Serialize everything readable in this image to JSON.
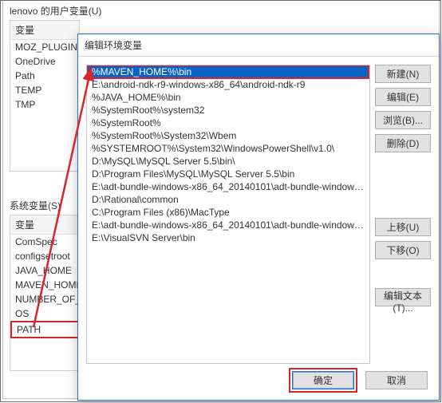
{
  "bg": {
    "user_vars_label": "lenovo 的用户变量(U)",
    "user_vars_header": "变量",
    "user_vars": [
      "MOZ_PLUGIN_P",
      "OneDrive",
      "Path",
      "TEMP",
      "TMP"
    ],
    "sys_vars_label": "系统变量(S)",
    "sys_vars_header": "变量",
    "sys_vars": [
      "ComSpec",
      "configsetroot",
      "JAVA_HOME",
      "MAVEN_HOME",
      "NUMBER_OF_PR",
      "OS",
      "PATH"
    ]
  },
  "dialog": {
    "title": "编辑环境变量",
    "entries": [
      "%MAVEN_HOME%\\bin",
      "E:\\android-ndk-r9-windows-x86_64\\android-ndk-r9",
      "%JAVA_HOME%\\bin",
      "%SystemRoot%\\system32",
      "%SystemRoot%",
      "%SystemRoot%\\System32\\Wbem",
      "%SYSTEMROOT%\\System32\\WindowsPowerShell\\v1.0\\",
      "D:\\MySQL\\MySQL Server 5.5\\bin\\",
      "D:\\Program Files\\MySQL\\MySQL Server 5.5\\bin",
      "E:\\adt-bundle-windows-x86_64_20140101\\adt-bundle-windows-x...",
      "D:\\Rational\\common",
      "C:\\Program Files (x86)\\MacType",
      "E:\\adt-bundle-windows-x86_64_20140101\\adt-bundle-windows-x...",
      "E:\\VisualSVN Server\\bin"
    ],
    "buttons": {
      "new": "新建(N)",
      "edit": "编辑(E)",
      "browse": "浏览(B)...",
      "delete": "删除(D)",
      "up": "上移(U)",
      "down": "下移(O)",
      "edit_text": "编辑文本(T)...",
      "ok": "确定",
      "cancel": "取消"
    }
  }
}
